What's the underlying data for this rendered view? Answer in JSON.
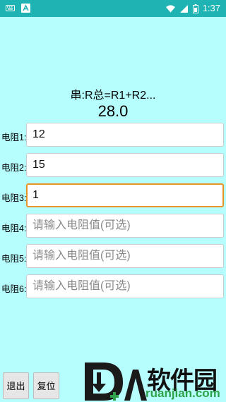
{
  "status_bar": {
    "time": "1:37",
    "icons": [
      "keyboard-icon",
      "a-icon",
      "wifi-icon",
      "signal-icon",
      "battery-icon"
    ]
  },
  "calc": {
    "formula": "串:R总=R1+R2...",
    "result": "28.0"
  },
  "resistors": [
    {
      "label": "电阻1:",
      "value": "12",
      "placeholder": ""
    },
    {
      "label": "电阻2:",
      "value": "15",
      "placeholder": ""
    },
    {
      "label": "电阻3:",
      "value": "1",
      "placeholder": ""
    },
    {
      "label": "电阻4:",
      "value": "",
      "placeholder": "请输入电阻值(可选)"
    },
    {
      "label": "电阻5:",
      "value": "",
      "placeholder": "请输入电阻值(可选)"
    },
    {
      "label": "电阻6:",
      "value": "",
      "placeholder": "请输入电阻值(可选)"
    }
  ],
  "buttons": {
    "exit": "退出",
    "reset": "复位"
  },
  "watermark": {
    "name": "软件园",
    "url": "ruanjian.com"
  },
  "colors": {
    "background": "#b6fdfd",
    "status_bar": "#1fb3b3",
    "focus_border": "#e8952c",
    "logo_green": "#2fa34a"
  }
}
